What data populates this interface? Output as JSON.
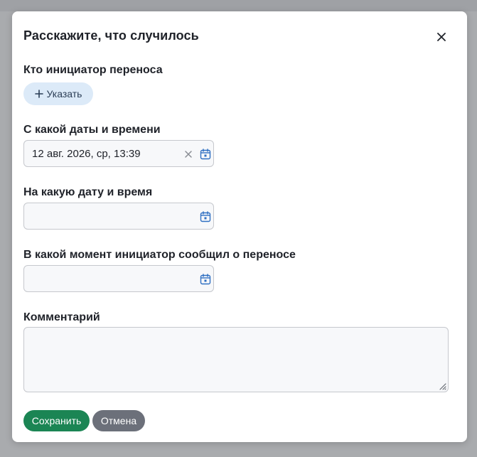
{
  "dialog": {
    "title": "Расскажите, что случилось"
  },
  "initiator": {
    "label": "Кто инициатор переноса",
    "add_button_label": "Указать"
  },
  "from_datetime": {
    "label": "С какой даты и времени",
    "value": "12 авг. 2026, ср, 13:39"
  },
  "to_datetime": {
    "label": "На какую дату и время",
    "value": ""
  },
  "notified_datetime": {
    "label": "В какой момент инициатор сообщил о переносе",
    "value": ""
  },
  "comment": {
    "label": "Комментарий",
    "value": ""
  },
  "actions": {
    "save_label": "Сохранить",
    "cancel_label": "Отмена"
  },
  "colors": {
    "save_button": "#1b8554",
    "cancel_button": "#6c707a",
    "pill_button": "#dceaf8",
    "calendar_icon": "#2f6fc2"
  }
}
